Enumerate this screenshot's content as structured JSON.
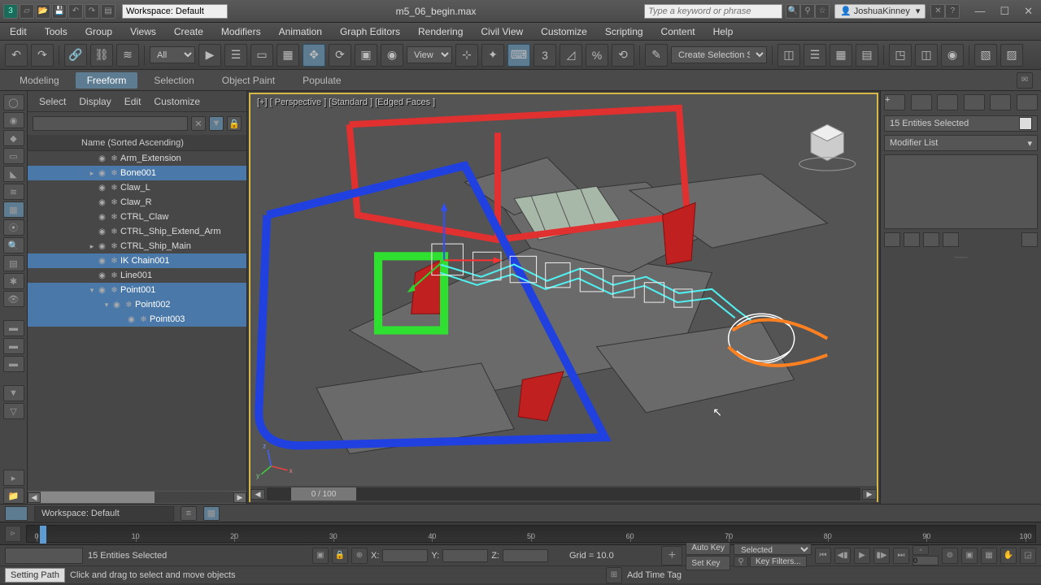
{
  "titlebar": {
    "workspace_label": "Workspace: Default",
    "filename": "m5_06_begin.max",
    "search_placeholder": "Type a keyword or phrase",
    "username": "JoshuaKinney"
  },
  "menubar": [
    "Edit",
    "Tools",
    "Group",
    "Views",
    "Create",
    "Modifiers",
    "Animation",
    "Graph Editors",
    "Rendering",
    "Civil View",
    "Customize",
    "Scripting",
    "Content",
    "Help"
  ],
  "toolbar": {
    "filter_all": "All",
    "view_label": "View",
    "sel_set": "Create Selection Se"
  },
  "ribbon_tabs": [
    {
      "label": "Modeling",
      "active": false
    },
    {
      "label": "Freeform",
      "active": true
    },
    {
      "label": "Selection",
      "active": false
    },
    {
      "label": "Object Paint",
      "active": false
    },
    {
      "label": "Populate",
      "active": false
    }
  ],
  "scene_tabs": [
    "Select",
    "Display",
    "Edit",
    "Customize"
  ],
  "scene_header": "Name (Sorted Ascending)",
  "scene_items": [
    {
      "name": "Arm_Extension",
      "depth": 0,
      "sel": false,
      "exp": ""
    },
    {
      "name": "Bone001",
      "depth": 0,
      "sel": true,
      "exp": "▸"
    },
    {
      "name": "Claw_L",
      "depth": 0,
      "sel": false,
      "exp": ""
    },
    {
      "name": "Claw_R",
      "depth": 0,
      "sel": false,
      "exp": ""
    },
    {
      "name": "CTRL_Claw",
      "depth": 0,
      "sel": false,
      "exp": ""
    },
    {
      "name": "CTRL_Ship_Extend_Arm",
      "depth": 0,
      "sel": false,
      "exp": ""
    },
    {
      "name": "CTRL_Ship_Main",
      "depth": 0,
      "sel": false,
      "exp": "▸"
    },
    {
      "name": "IK Chain001",
      "depth": 0,
      "sel": true,
      "exp": ""
    },
    {
      "name": "Line001",
      "depth": 0,
      "sel": false,
      "exp": ""
    },
    {
      "name": "Point001",
      "depth": 0,
      "sel": true,
      "exp": "▾"
    },
    {
      "name": "Point002",
      "depth": 1,
      "sel": true,
      "exp": "▾"
    },
    {
      "name": "Point003",
      "depth": 2,
      "sel": true,
      "exp": ""
    }
  ],
  "viewport": {
    "label": "[+] [ Perspective ] [Standard ] [Edged Faces ]",
    "frame_label": "0 / 100"
  },
  "right_panel": {
    "selection_info": "15 Entities Selected",
    "modifier_list": "Modifier List"
  },
  "timeline": {
    "ticks": [
      0,
      10,
      20,
      30,
      40,
      50,
      60,
      70,
      80,
      90,
      100
    ]
  },
  "status": {
    "sel_msg": "15 Entities Selected",
    "hint": "Click and drag to select and move objects",
    "x_label": "X:",
    "y_label": "Y:",
    "z_label": "Z:",
    "grid": "Grid = 10.0",
    "auto_key": "Auto Key",
    "set_key": "Set Key",
    "selected": "Selected",
    "key_filters": "Key Filters...",
    "add_tag": "Add Time Tag",
    "tooltip": "Setting Path",
    "zero": "0"
  },
  "bottom": {
    "workspace": "Workspace: Default"
  }
}
